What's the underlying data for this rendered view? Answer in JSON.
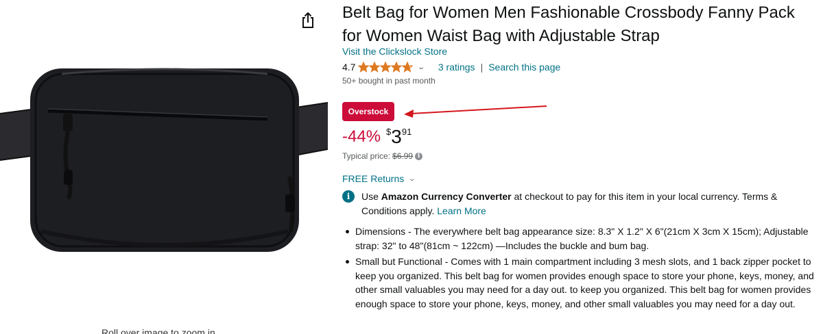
{
  "product": {
    "title": "Belt Bag for Women Men Fashionable Crossbody Fanny Pack for Women Waist Bag with Adjustable Strap",
    "store_link": "Visit the Clickslock Store",
    "rating": "4.7",
    "rating_stars": 4.7,
    "ratings_count": "3 ratings",
    "separator": "|",
    "search_page": "Search this page",
    "bought": "50+ bought in past month",
    "zoom_hint": "Roll over image to zoom in"
  },
  "badge": {
    "label": "Overstock"
  },
  "price": {
    "discount": "-44%",
    "currency": "$",
    "whole": "3",
    "fraction": "91",
    "typical_label": "Typical price:",
    "typical_value": "$6.99"
  },
  "returns": {
    "label": "FREE Returns"
  },
  "currency_note": {
    "prefix": "Use ",
    "bold": "Amazon Currency Converter",
    "suffix": " at checkout to pay for this item in your local currency. Terms & Conditions apply. ",
    "link": "Learn More"
  },
  "bullets": [
    "Dimensions - The everywhere belt bag appearance size: 8.3\" X 1.2\" X 6\"(21cm X 3cm X 15cm); Adjustable strap: 32\" to 48\"(81cm ~ 122cm) —Includes the buckle and bum bag.",
    "Small but Functional - Comes with 1 main compartment including 3 mesh slots, and 1 back zipper pocket to keep you organized. This belt bag for women provides enough space to store your phone, keys, money, and other small valuables you may need for a day out. to keep you organized. This belt bag for women provides enough space to store your phone, keys, money, and other small valuables you may need for a day out."
  ],
  "colors": {
    "link": "#007185",
    "badge": "#cc0c39",
    "discount": "#cc0c39",
    "star": "#de7921",
    "arrow": "#d4161c"
  },
  "icons": [
    "share-icon",
    "star-icon",
    "chevron-down-icon",
    "info-icon"
  ]
}
